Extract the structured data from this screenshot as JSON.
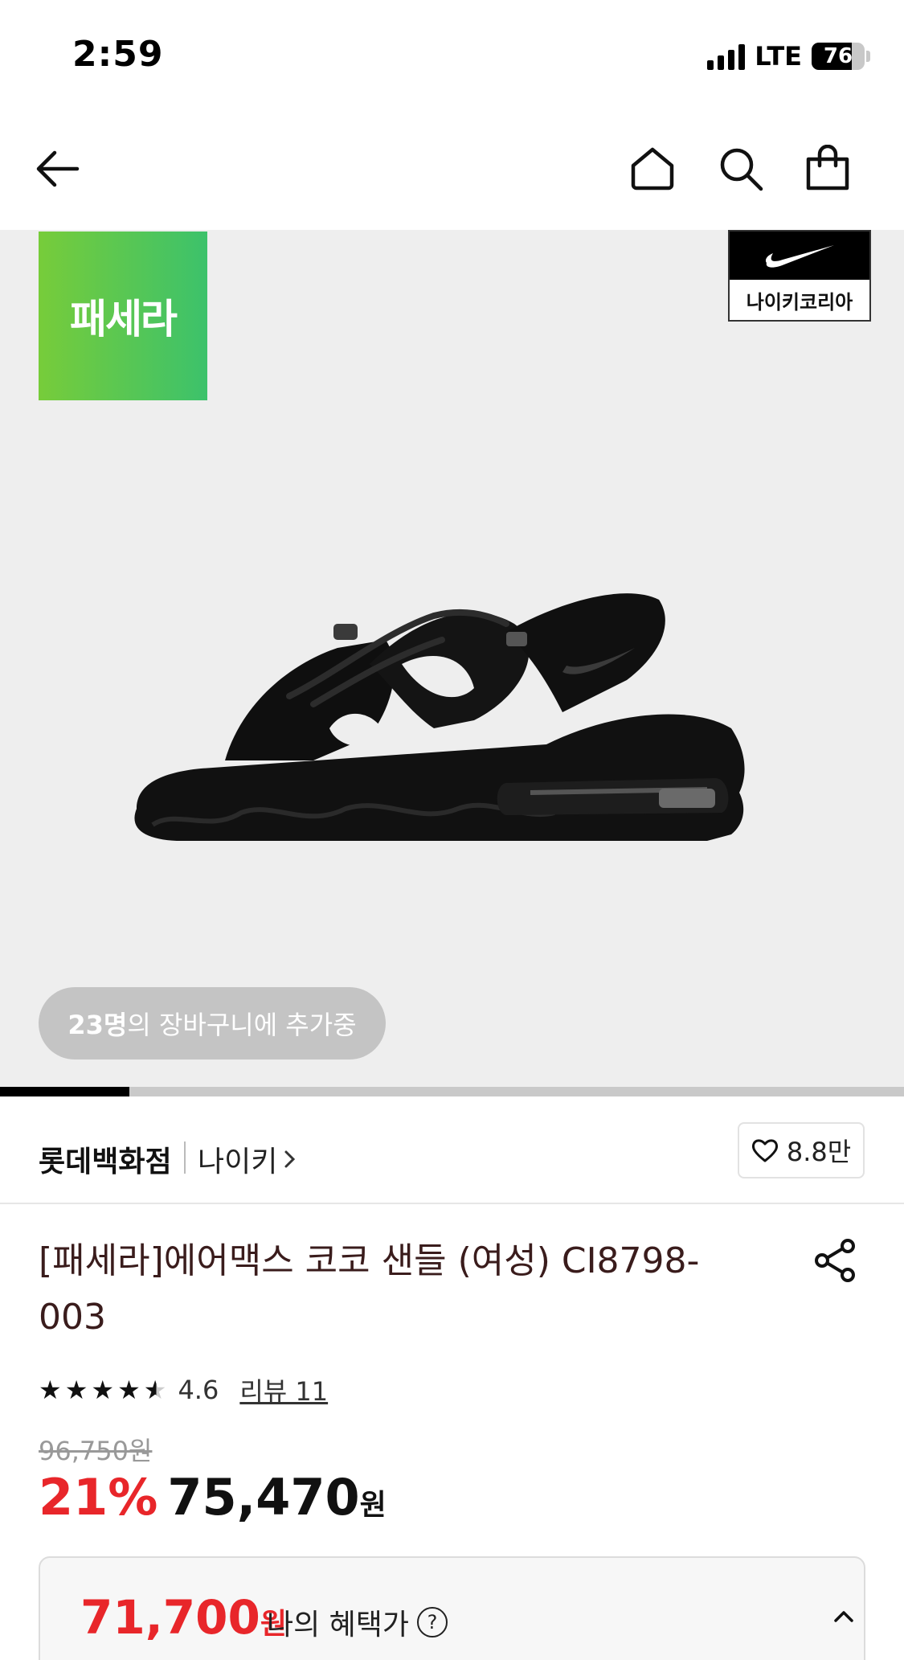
{
  "status_bar": {
    "time": "2:59",
    "network": "LTE",
    "battery": "76",
    "battery_level": 0.76
  },
  "nav": {
    "icons": [
      "back-arrow-icon",
      "home-icon",
      "search-icon",
      "shopping-bag-icon"
    ]
  },
  "gallery": {
    "pasera_badge": "패세라",
    "brand_badge": "나이키코리아",
    "cart_count_strong": "23명",
    "cart_count_rest": "의 장바구니에 추가중",
    "image_progress": 0.143
  },
  "store": {
    "name": "롯데백화점",
    "brand": "나이키",
    "likes": "8.8만"
  },
  "product": {
    "title": "[패세라]에어맥스 코코 샌들 (여성) CI8798-003",
    "rating": "4.6",
    "rating_value": 4.6,
    "reviews": "리뷰 11",
    "original_price": "96,750원",
    "discount": "21%",
    "sale_price": "75,470",
    "sale_unit": "원"
  },
  "benefit": {
    "price": "71,700",
    "unit": "원",
    "label": "나의 혜택가"
  },
  "colors": {
    "accent_red": "#e8262a",
    "badge_green": "#4cc552"
  }
}
